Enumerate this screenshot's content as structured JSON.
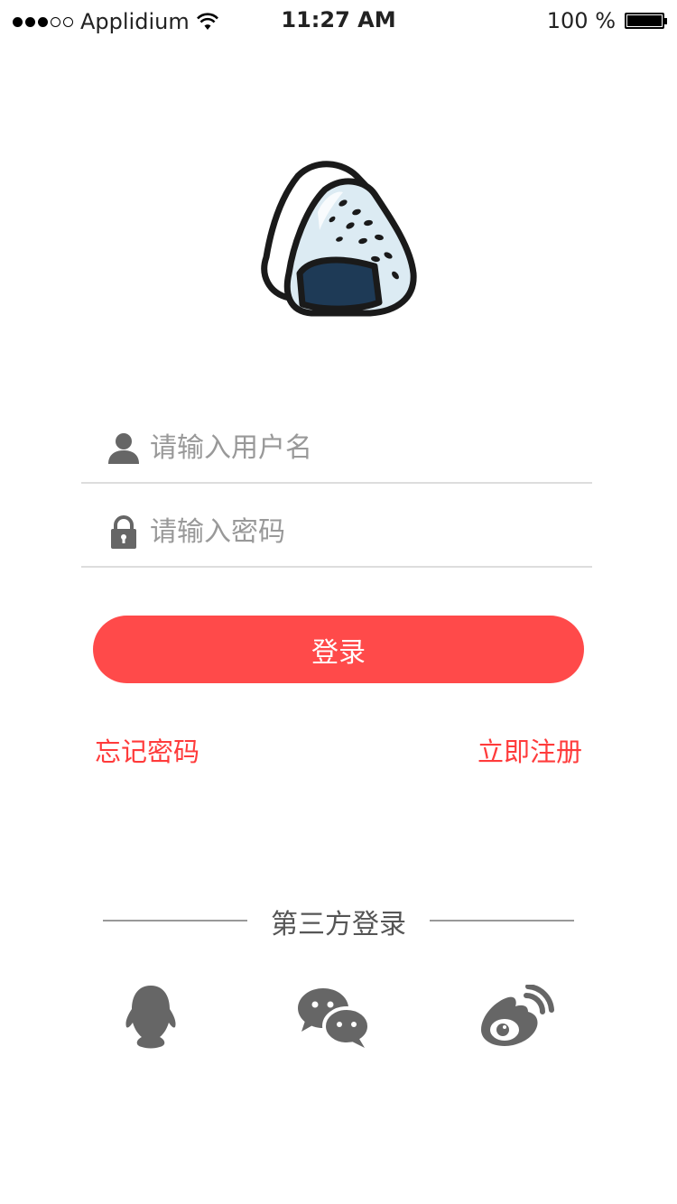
{
  "status_bar": {
    "carrier": "Applidium",
    "time": "11:27 AM",
    "battery_text": "100 %"
  },
  "login_form": {
    "username_placeholder": "请输入用户名",
    "password_placeholder": "请输入密码",
    "login_label": "登录",
    "forgot_label": "忘记密码",
    "register_label": "立即注册"
  },
  "third_party": {
    "title": "第三方登录"
  },
  "colors": {
    "accent": "#ff4a4a",
    "link": "#ff3b3b",
    "icon": "#666666",
    "placeholder": "#999999",
    "divider": "#dddddd"
  },
  "icons": {
    "username": "person-icon",
    "password": "lock-icon",
    "qq": "qq-icon",
    "wechat": "wechat-icon",
    "weibo": "weibo-icon",
    "logo": "onigiri-logo"
  }
}
